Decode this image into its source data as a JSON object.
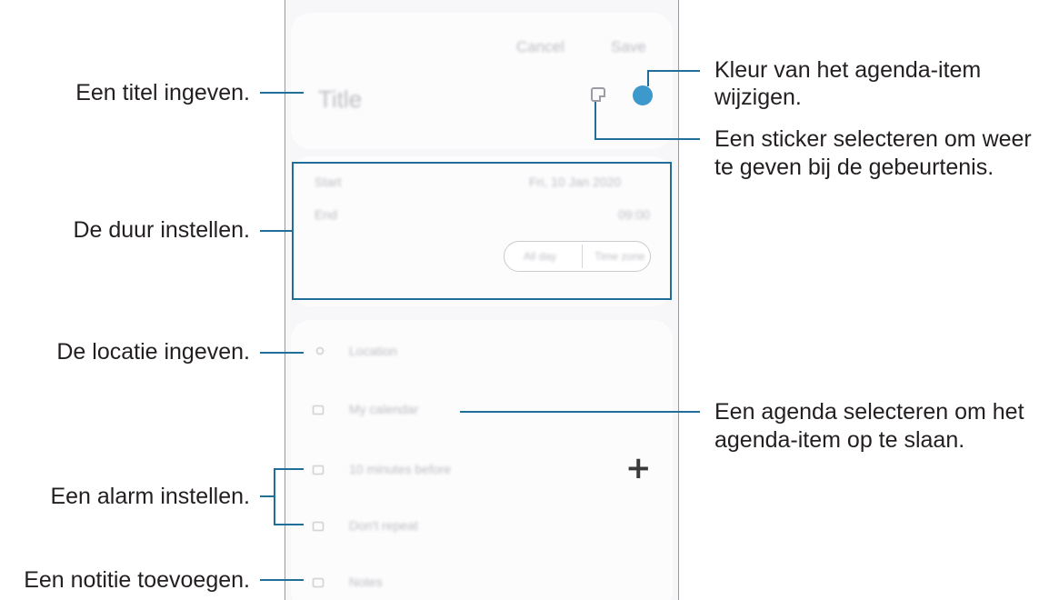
{
  "callouts": {
    "title": "Een titel ingeven.",
    "duration": "De duur instellen.",
    "location": "De locatie ingeven.",
    "alarm": "Een alarm instellen.",
    "note": "Een notitie toevoegen.",
    "color_line1": "Kleur van het agenda-item",
    "color_line2": "wijzigen.",
    "sticker_line1": "Een sticker selecteren om weer",
    "sticker_line2": "te geven bij de gebeurtenis.",
    "calendar_line1": "Een agenda selecteren om het",
    "calendar_line2": "agenda-item op te slaan."
  },
  "app": {
    "cancel_label": "Cancel",
    "save_label": "Save",
    "title_placeholder": "Title",
    "start_label": "Start",
    "start_value": "Fri, 10 Jan 2020",
    "end_label": "End",
    "end_value": "09:00",
    "allday_label": "All day",
    "timezone_label": "Time zone",
    "location_placeholder": "Location",
    "calendar_value": "My calendar",
    "alarm_value": "10 minutes before",
    "repeat_value": "Don't repeat",
    "notes_placeholder": "Notes",
    "add_alarm_symbol": "+"
  },
  "colors": {
    "accent_line": "#1f6f99",
    "event_color": "#3d98cc"
  },
  "icons": [
    "sticker-icon",
    "color-dot-icon",
    "location-icon",
    "calendar-icon",
    "alarm-icon",
    "repeat-icon",
    "notes-icon",
    "plus-icon"
  ]
}
